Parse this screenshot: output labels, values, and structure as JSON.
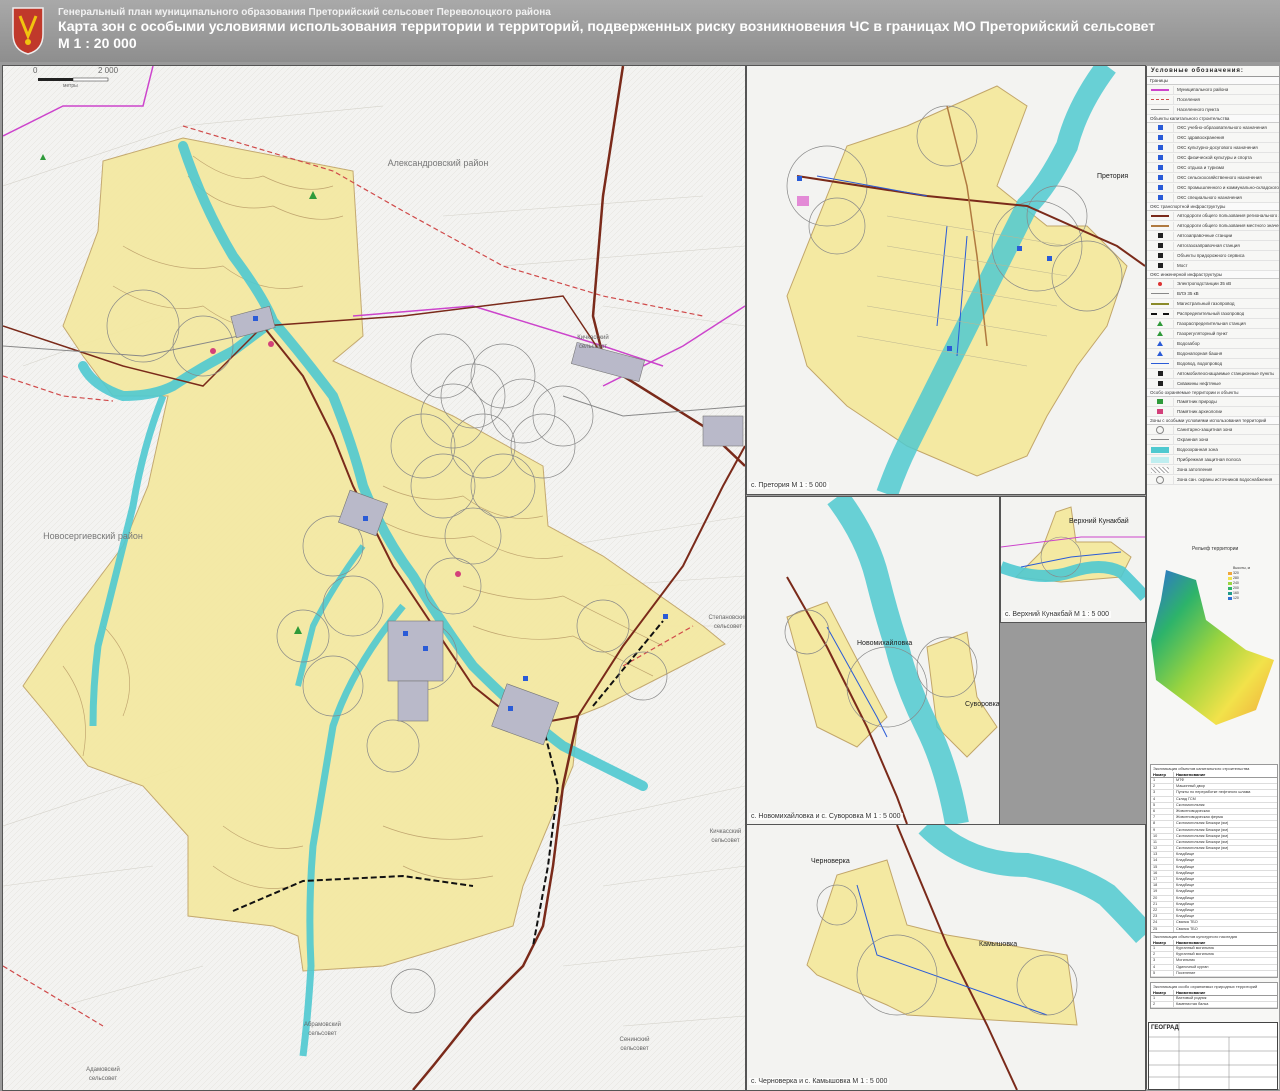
{
  "header": {
    "subtitle": "Генеральный план муниципального образования Преторийский сельсовет Переволоцкого района",
    "title": "Карта зон с особыми условиями использования территории и территорий, подверженных риску возникновения ЧС в границах МО Преторийский сельсовет",
    "scale": "М 1 : 20 000"
  },
  "main_map": {
    "scalebar": {
      "zero": "0",
      "max": "2 000",
      "unit": "метры"
    },
    "places": {
      "aleksandrovsky": "Александровский район",
      "novosergievsky": "Новосергиевский район",
      "kuvandyk_ss": "Кичкасский сельсовет",
      "stepanovsky": "Степановский сельсовет",
      "kichkassky": "Кичкасский сельсовет",
      "abramovsky": "Абрамовский сельсовет",
      "seninsky": "Сенинский сельсовет",
      "adamovsky": "Адамовский сельсовет"
    }
  },
  "insets": {
    "pretoria": {
      "caption": "с. Претория М 1 : 5 000",
      "label": "Претория"
    },
    "verkhny": {
      "caption": "с. Верхний Кунакбай М 1 : 5 000",
      "label": "Верхний Кунакбай"
    },
    "novomikh": {
      "caption": "с. Новомихайловка и с. Суворовка М 1 : 5 000",
      "label1": "Новомихайловка",
      "label2": "Суворовка"
    },
    "chernoz": {
      "caption": "с. Черноверка и с. Камышовка М 1 : 5 000",
      "label1": "Черноверка",
      "label2": "Камышовка"
    }
  },
  "legend": {
    "title": "Условные обозначения:",
    "sections": [
      {
        "title": "Границы",
        "items": [
          {
            "icon": "line-magenta",
            "text": "Муниципального района"
          },
          {
            "icon": "line-purple",
            "text": "Поселения"
          },
          {
            "icon": "line-gray",
            "text": "Населенного пункта"
          }
        ]
      },
      {
        "title": "Объекты капитального строительства",
        "items": [
          {
            "icon": "square-blue",
            "text": "ОКС учебно-образовательного назначения"
          },
          {
            "icon": "square-blue",
            "text": "ОКС здравоохранения"
          },
          {
            "icon": "square-blue",
            "text": "ОКС культурно-досугового назначения"
          },
          {
            "icon": "square-blue",
            "text": "ОКС физической культуры и спорта"
          },
          {
            "icon": "square-blue",
            "text": "ОКС отдыха и туризма"
          },
          {
            "icon": "square-blue",
            "text": "ОКС сельскохозяйственного назначения"
          },
          {
            "icon": "square-blue",
            "text": "ОКС промышленного и коммунально-складского назначения"
          },
          {
            "icon": "square-blue",
            "text": "ОКС специального назначения"
          }
        ]
      },
      {
        "title": "ОКС транспортной инфраструктуры",
        "items": [
          {
            "icon": "line-darkred",
            "text": "Автодороги общего пользования регионального значения"
          },
          {
            "icon": "line-brown",
            "text": "Автодороги общего пользования местного значения"
          },
          {
            "icon": "square-black",
            "text": "Автозаправочные станции"
          },
          {
            "icon": "square-black",
            "text": "Автогазозаправочная станция"
          },
          {
            "icon": "square-black",
            "text": "Объекты придорожного сервиса"
          },
          {
            "icon": "square-black",
            "text": "Мост"
          }
        ]
      },
      {
        "title": "ОКС инженерной инфраструктуры",
        "items": [
          {
            "icon": "dot-red",
            "text": "Электроподстанции 35 кВ"
          },
          {
            "icon": "line-gray",
            "text": "ВЛЭ 35 кВ"
          },
          {
            "icon": "line-olive",
            "text": "Магистральный газопровод"
          },
          {
            "icon": "line-black",
            "text": "Распределительный газопровод"
          },
          {
            "icon": "tri-green",
            "text": "Газораспределительная станция"
          },
          {
            "icon": "tri-green",
            "text": "Газорегуляторный пункт"
          },
          {
            "icon": "tri-blue",
            "text": "Водозабор"
          },
          {
            "icon": "tri-blue",
            "text": "Водонапорная башня"
          },
          {
            "icon": "line-blue",
            "text": "Водовод, водопровод"
          },
          {
            "icon": "square-black",
            "text": "Автомобилеоснащаемые станционные пункты"
          },
          {
            "icon": "square-black",
            "text": "Скважины нефтяные"
          }
        ]
      },
      {
        "title": "Особо охраняемые территории и объекты",
        "items": [
          {
            "icon": "square-green",
            "text": "Памятник природы"
          },
          {
            "icon": "square-pink",
            "text": "Памятник археологии"
          }
        ]
      },
      {
        "title": "Зоны с особыми условиями использования территорий",
        "items": [
          {
            "icon": "circle-gray",
            "text": "Санитарно-защитная зона"
          },
          {
            "icon": "line-gray",
            "text": "Охранная зона"
          },
          {
            "icon": "fill-cyan",
            "text": "Водоохранная зона"
          },
          {
            "icon": "fill-lightcyan",
            "text": "Прибрежная защитная полоса"
          },
          {
            "icon": "fill-hatch",
            "text": "Зона затопления"
          },
          {
            "icon": "circle-gray",
            "text": "Зона сан. охраны источников водоснабжения"
          }
        ]
      }
    ]
  },
  "relief": {
    "title": "Рельеф территории",
    "legend_title": "Высоты, м",
    "levels": [
      "320",
      "280",
      "240",
      "200",
      "160",
      "120"
    ]
  },
  "table1": {
    "caption": "Экспликация объектов капитального строительства",
    "header": [
      "Номер",
      "Наименование"
    ],
    "rows": [
      [
        "1",
        "МТФ"
      ],
      [
        "2",
        "Машинный двор"
      ],
      [
        "3",
        "Пункты по переработке нефтяного шлама"
      ],
      [
        "4",
        "Склад ГСМ"
      ],
      [
        "5",
        "Скотомогильник"
      ],
      [
        "6",
        "Животноводческая"
      ],
      [
        "7",
        "Животноводческая ферма"
      ],
      [
        "8",
        "Скотомогильник Беккари (ям)"
      ],
      [
        "9",
        "Скотомогильник Беккари (ям)"
      ],
      [
        "10",
        "Скотомогильник Беккари (ям)"
      ],
      [
        "11",
        "Скотомогильник Беккари (ям)"
      ],
      [
        "12",
        "Скотомогильник Беккари (ям)"
      ],
      [
        "13",
        "Кладбище"
      ],
      [
        "14",
        "Кладбище"
      ],
      [
        "15",
        "Кладбище"
      ],
      [
        "16",
        "Кладбище"
      ],
      [
        "17",
        "Кладбище"
      ],
      [
        "18",
        "Кладбище"
      ],
      [
        "19",
        "Кладбище"
      ],
      [
        "20",
        "Кладбище"
      ],
      [
        "21",
        "Кладбище"
      ],
      [
        "22",
        "Кладбище"
      ],
      [
        "23",
        "Кладбище"
      ],
      [
        "24",
        "Свалка ТБО"
      ],
      [
        "25",
        "Свалка ТБО"
      ],
      [
        "26",
        "Свалка ТБО"
      ],
      [
        "27",
        "Скважина"
      ],
      [
        "28",
        "Скважина"
      ],
      [
        "29",
        "Скважина"
      ]
    ]
  },
  "table2": {
    "caption": "Экспликация объектов культурного наследия",
    "header": [
      "Номер",
      "Наименование"
    ],
    "rows": [
      [
        "1",
        "Курганный могильник"
      ],
      [
        "2",
        "Курганный могильник"
      ],
      [
        "3",
        "Могильник"
      ],
      [
        "4",
        "Одиночный курган"
      ],
      [
        "5",
        "Поселение"
      ]
    ]
  },
  "table3": {
    "caption": "Экспликация особо охраняемых природных территорий",
    "header": [
      "Номер",
      "Наименование"
    ],
    "rows": [
      [
        "1",
        "Вахтовый родник"
      ],
      [
        "2",
        "Каменистая балка"
      ]
    ]
  },
  "stamp": {
    "company": "ГЕОГРАД"
  },
  "colors": {
    "territory": "#f4e9a2",
    "water": "#4fc9d0",
    "water_zone": "#8adfe3",
    "road_regional": "#7a2a1a",
    "road_local": "#b07a40",
    "boundary_district": "#cc44cc",
    "contour": "#b59663"
  }
}
